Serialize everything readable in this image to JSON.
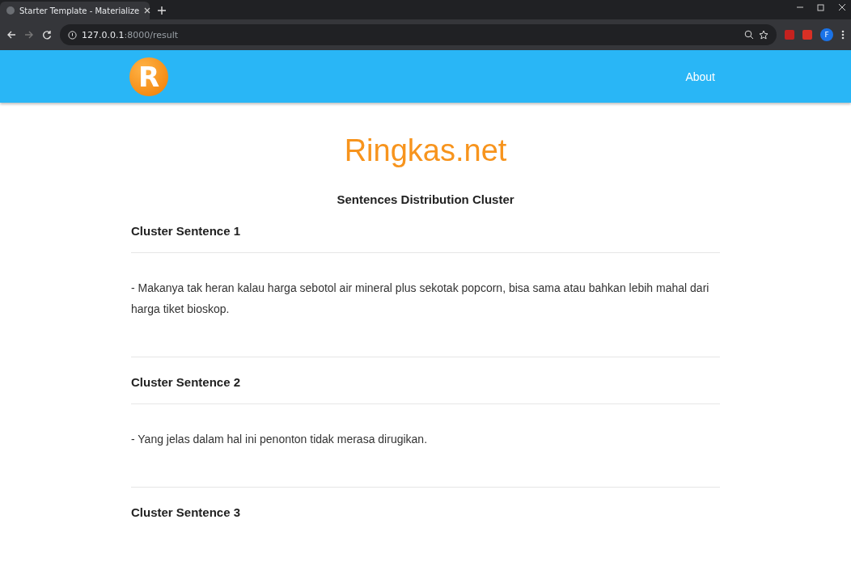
{
  "browser": {
    "tab_title": "Starter Template - Materialize",
    "url_host": "127.0.0.1",
    "url_path": ":8000/result",
    "profile_letter": "F"
  },
  "navbar": {
    "logo_letter": "R",
    "links": [
      "About"
    ]
  },
  "page": {
    "title": "Ringkas.net",
    "heading": "Sentences Distribution Cluster",
    "clusters": [
      {
        "title": "Cluster Sentence 1",
        "sentences": [
          "- Makanya tak heran kalau harga sebotol air mineral plus sekotak popcorn, bisa sama atau bahkan lebih mahal dari harga tiket bioskop."
        ]
      },
      {
        "title": "Cluster Sentence 2",
        "sentences": [
          "- Yang jelas dalam hal ini penonton tidak merasa dirugikan."
        ]
      },
      {
        "title": "Cluster Sentence 3"
      }
    ]
  }
}
